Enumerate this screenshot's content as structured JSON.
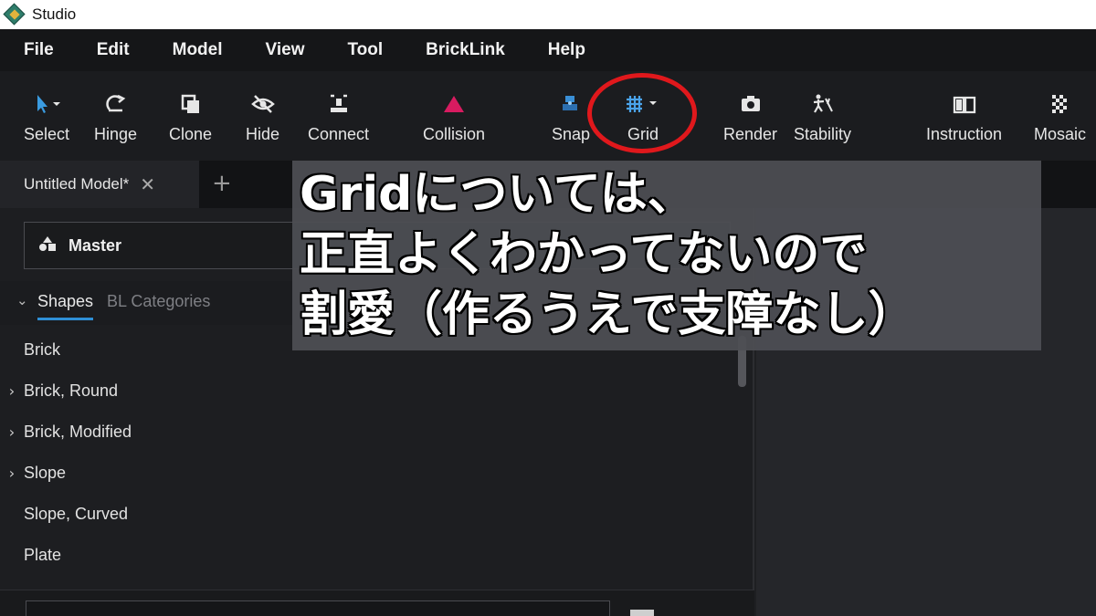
{
  "window": {
    "title": "Studio"
  },
  "menu": [
    "File",
    "Edit",
    "Model",
    "View",
    "Tool",
    "BrickLink",
    "Help"
  ],
  "toolbar": {
    "select": "Select",
    "hinge": "Hinge",
    "clone": "Clone",
    "hide": "Hide",
    "connect": "Connect",
    "collision": "Collision",
    "snap": "Snap",
    "grid": "Grid",
    "render": "Render",
    "stability": "Stability",
    "instruction": "Instruction",
    "mosaic": "Mosaic"
  },
  "tabs": {
    "document": "Untitled Model*",
    "close": "✕",
    "add": "+"
  },
  "palette": {
    "selected": "Master"
  },
  "subtabs": {
    "shapes": "Shapes",
    "bl_categories": "BL Categories"
  },
  "categories": [
    {
      "name": "Brick",
      "expandable": false
    },
    {
      "name": "Brick, Round",
      "expandable": true
    },
    {
      "name": "Brick, Modified",
      "expandable": true
    },
    {
      "name": "Slope",
      "expandable": true
    },
    {
      "name": "Slope, Curved",
      "expandable": false
    },
    {
      "name": "Plate",
      "expandable": false
    }
  ],
  "caption": {
    "line1": "Gridについては、",
    "line2": "正直よくわかってないので",
    "line3": "割愛（作るうえで支障なし）"
  },
  "colors": {
    "accent": "#2f8fd6",
    "highlight_circle": "#e0181c",
    "collision": "#d81b60",
    "snap": "#3a8fd6",
    "grid": "#4aa3ea"
  }
}
